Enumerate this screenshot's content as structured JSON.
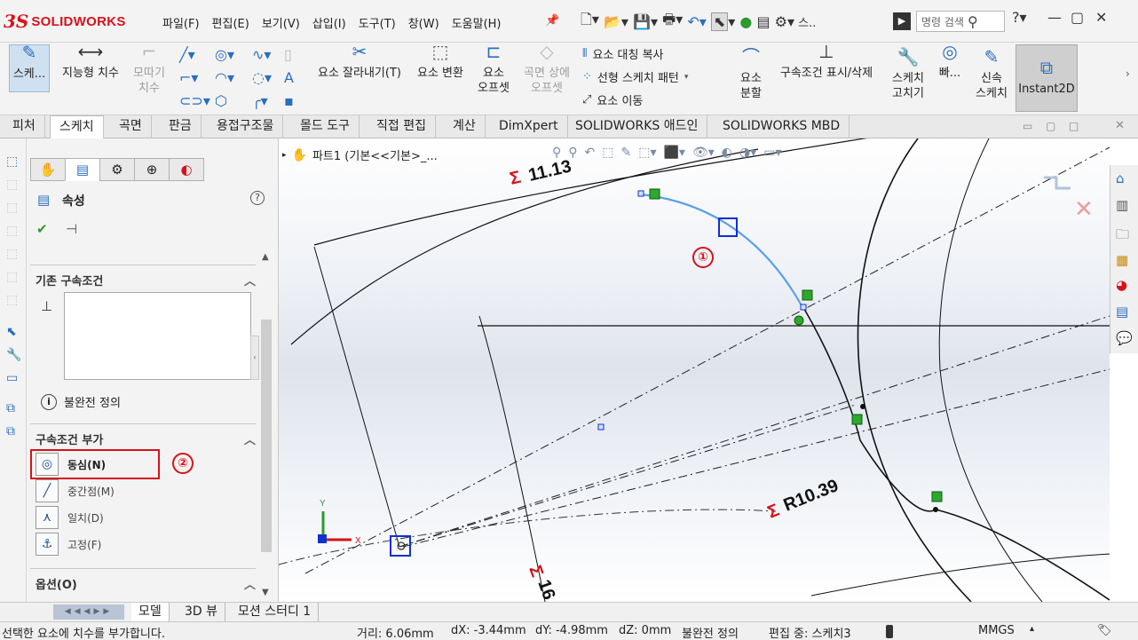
{
  "app": {
    "logo_prefix": "3S",
    "logo_text": "SOLIDWORKS"
  },
  "menu": [
    "파일(F)",
    "편집(E)",
    "보기(V)",
    "삽입(I)",
    "도구(T)",
    "창(W)",
    "도움말(H)"
  ],
  "search": {
    "placeholder": "명령 검색"
  },
  "command_manager": {
    "sketch": "스케...",
    "smart_dimension": "지능형 치수",
    "fillet_line1": "모따기",
    "fillet_line2": "치수",
    "trim": "요소 잘라내기(T)",
    "convert": "요소 변환",
    "offset_line1": "요소",
    "offset_line2": "오프셋",
    "surface_offset_line1": "곡면 상에",
    "surface_offset_line2": "오프셋",
    "mirror": "요소 대칭 복사",
    "linear_pattern": "선형 스케치 패턴",
    "move": "요소 이동",
    "split_line1": "요소",
    "split_line2": "분할",
    "display_relations": "구속조건 표시/삭제",
    "repair_line1": "스케치",
    "repair_line2": "고치기",
    "quick_snaps": "빠...",
    "rapid_line1": "신속",
    "rapid_line2": "스케치",
    "instant2d": "Instant2D"
  },
  "tabs": [
    "피처",
    "스케치",
    "곡면",
    "판금",
    "용접구조물",
    "몰드 도구",
    "직접 편집",
    "계산",
    "DimXpert",
    "SOLIDWORKS 애드인",
    "SOLIDWORKS MBD"
  ],
  "active_tab": "스케치",
  "property_manager": {
    "title": "속성",
    "existing_relations_header": "기존 구속조건",
    "status": "불완전 정의",
    "add_relations_header": "구속조건 부가",
    "relations": [
      {
        "label": "동심(N)",
        "icon": "concentric-icon"
      },
      {
        "label": "중간점(M)",
        "icon": "midpoint-icon"
      },
      {
        "label": "일치(D)",
        "icon": "coincident-icon"
      },
      {
        "label": "고정(F)",
        "icon": "fix-icon"
      }
    ],
    "options_header": "옵션(O)"
  },
  "viewport": {
    "tree_path": "파트1  (기본<<기본>_...",
    "dimensions": {
      "top": "11.13",
      "radius": "R10.39",
      "bottom": "16"
    },
    "triad_axes": {
      "x": "X",
      "y": "Y"
    }
  },
  "annotations": {
    "marker1": "①",
    "marker2": "②"
  },
  "bottom_tabs": [
    "모델",
    "3D 뷰",
    "모션 스터디 1"
  ],
  "status_bar": {
    "message": "선택한 요소에 치수를 부가합니다.",
    "distance": "거리: 6.06mm",
    "dx": "dX: -3.44mm",
    "dy": "dY: -4.98mm",
    "dz": "dZ: 0mm",
    "state": "불완전 정의",
    "editing": "편집 중: 스케치3",
    "units": "MMGS"
  },
  "colors": {
    "brand": "#d6121a",
    "selected_arc": "#5aa0e6",
    "sketch_line": "#111111",
    "relation_marker": "#2ea82e",
    "selection_box": "#1030d0"
  }
}
